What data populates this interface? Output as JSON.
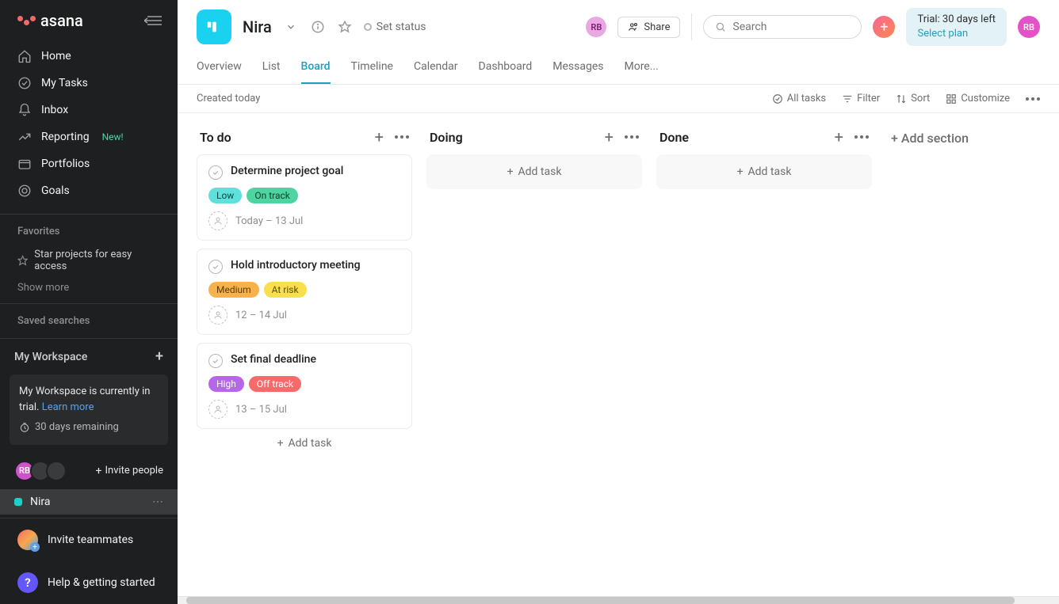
{
  "brand": "asana",
  "sidebar": {
    "nav": [
      {
        "label": "Home",
        "icon": "home"
      },
      {
        "label": "My Tasks",
        "icon": "check"
      },
      {
        "label": "Inbox",
        "icon": "bell"
      },
      {
        "label": "Reporting",
        "icon": "chart",
        "badge": "New!"
      },
      {
        "label": "Portfolios",
        "icon": "folder"
      },
      {
        "label": "Goals",
        "icon": "target"
      }
    ],
    "favorites_title": "Favorites",
    "favorites_hint": "Star projects for easy access",
    "show_more": "Show more",
    "saved_searches_title": "Saved searches",
    "workspace_title": "My Workspace",
    "trial_msg_1": "My Workspace is currently in trial. ",
    "trial_learn_more": "Learn more",
    "trial_remaining": "30 days remaining",
    "invite_people": "Invite people",
    "project_item": "Nira",
    "invite_teammates": "Invite teammates",
    "help": "Help & getting started"
  },
  "project": {
    "name": "Nira",
    "set_status": "Set status",
    "tabs": [
      "Overview",
      "List",
      "Board",
      "Timeline",
      "Calendar",
      "Dashboard",
      "Messages",
      "More..."
    ],
    "active_tab": "Board",
    "created_label": "Created today"
  },
  "header": {
    "share": "Share",
    "search_placeholder": "Search",
    "trial_line1": "Trial: 30 days left",
    "select_plan": "Select plan",
    "user_initials": "RB"
  },
  "toolbar": {
    "all_tasks": "All tasks",
    "filter": "Filter",
    "sort": "Sort",
    "customize": "Customize"
  },
  "board": {
    "columns": [
      {
        "title": "To do",
        "cards": [
          {
            "title": "Determine project goal",
            "tags": [
              {
                "t": "Low",
                "c": "low"
              },
              {
                "t": "On track",
                "c": "ontrack"
              }
            ],
            "date": "Today – 13 Jul"
          },
          {
            "title": "Hold introductory meeting",
            "tags": [
              {
                "t": "Medium",
                "c": "medium"
              },
              {
                "t": "At risk",
                "c": "atrisk"
              }
            ],
            "date": "12 – 14 Jul"
          },
          {
            "title": "Set final deadline",
            "tags": [
              {
                "t": "High",
                "c": "high"
              },
              {
                "t": "Off track",
                "c": "offtrack"
              }
            ],
            "date": "13 – 15 Jul"
          }
        ]
      },
      {
        "title": "Doing",
        "cards": []
      },
      {
        "title": "Done",
        "cards": []
      }
    ],
    "add_task": "Add task",
    "add_section": "+ Add section"
  }
}
